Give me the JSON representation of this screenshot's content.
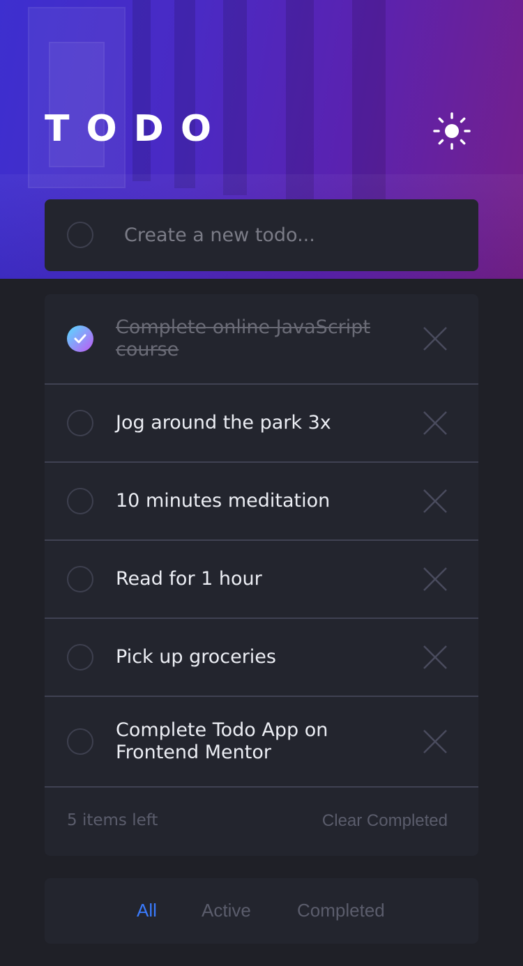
{
  "header": {
    "title": "TODO",
    "theme_toggle_icon": "sun-icon"
  },
  "new_todo": {
    "placeholder": "Create a new todo..."
  },
  "todos": [
    {
      "text": "Complete online JavaScript course",
      "completed": true
    },
    {
      "text": "Jog around the park 3x",
      "completed": false
    },
    {
      "text": "10 minutes meditation",
      "completed": false
    },
    {
      "text": "Read for 1 hour",
      "completed": false
    },
    {
      "text": "Pick up groceries",
      "completed": false
    },
    {
      "text": "Complete Todo App on Frontend Mentor",
      "completed": false
    }
  ],
  "footer": {
    "items_left": "5 items left",
    "clear_completed": "Clear Completed"
  },
  "filters": {
    "all": "All",
    "active": "Active",
    "completed": "Completed",
    "selected": "All"
  },
  "colors": {
    "accent": "#3a7bfd",
    "check_gradient_start": "#57ddff",
    "check_gradient_end": "#c058f3",
    "panel": "#23252e",
    "background": "#1f2027"
  }
}
